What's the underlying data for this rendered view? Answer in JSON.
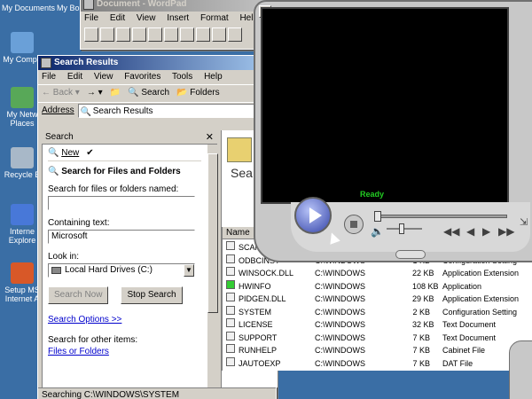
{
  "desktop": {
    "top_items": [
      "My Documents",
      "My Bo"
    ],
    "icons": [
      {
        "label": "My Compu",
        "color": "#6aa0d8"
      },
      {
        "label": "My Netw Places",
        "color": "#58a858"
      },
      {
        "label": "Recycle B",
        "color": "#a8b8c8"
      },
      {
        "label": "Interne Explore",
        "color": "#4878d8"
      },
      {
        "label": "Setup MS Internet A",
        "color": "#d85828"
      }
    ]
  },
  "wordpad": {
    "title": "Document - WordPad",
    "menu": [
      "File",
      "Edit",
      "View",
      "Insert",
      "Format",
      "Help"
    ]
  },
  "search_window": {
    "title": "Search Results",
    "menu": [
      "File",
      "Edit",
      "View",
      "Favorites",
      "Tools",
      "Help"
    ],
    "toolbar": {
      "back": "Back",
      "search": "Search",
      "folders": "Folders"
    },
    "address_label": "Address",
    "address_value": "Search Results",
    "pane_title": "Search",
    "pane_new": "New",
    "pane_heading": "Search for Files and Folders",
    "named_label": "Search for files or folders named:",
    "named_value": "",
    "containing_label": "Containing text:",
    "containing_value": "Microsoft",
    "lookin_label": "Look in:",
    "lookin_value": "Local Hard Drives (C:)",
    "search_now": "Search Now",
    "stop_search": "Stop Search",
    "search_options": "Search Options >>",
    "other_items": "Search for other items:",
    "files_folders": "Files or Folders",
    "results_label": "Sea",
    "status": "Searching C:\\WINDOWS\\SYSTEM"
  },
  "file_list": {
    "headers": {
      "name": "Name"
    },
    "rows": [
      {
        "name": "SCANDISK.LOG",
        "folder": "",
        "size": "",
        "type": ""
      },
      {
        "name": "ODBCINST",
        "folder": "C:\\WINDOWS",
        "size": "1 KB",
        "type": "Configuration Setting"
      },
      {
        "name": "WINSOCK.DLL",
        "folder": "C:\\WINDOWS",
        "size": "22 KB",
        "type": "Application Extension"
      },
      {
        "name": "HWINFO",
        "folder": "C:\\WINDOWS",
        "size": "108 KB",
        "type": "Application"
      },
      {
        "name": "PIDGEN.DLL",
        "folder": "C:\\WINDOWS",
        "size": "29 KB",
        "type": "Application Extension"
      },
      {
        "name": "SYSTEM",
        "folder": "C:\\WINDOWS",
        "size": "2 KB",
        "type": "Configuration Setting"
      },
      {
        "name": "LICENSE",
        "folder": "C:\\WINDOWS",
        "size": "32 KB",
        "type": "Text Document"
      },
      {
        "name": "SUPPORT",
        "folder": "C:\\WINDOWS",
        "size": "7 KB",
        "type": "Text Document"
      },
      {
        "name": "RUNHELP",
        "folder": "C:\\WINDOWS",
        "size": "7 KB",
        "type": "Cabinet File"
      },
      {
        "name": "JAUTOEXP",
        "folder": "C:\\WINDOWS",
        "size": "7 KB",
        "type": "DAT File"
      }
    ]
  },
  "media_player": {
    "status": "Ready",
    "volume": 0.4,
    "position": 0
  }
}
